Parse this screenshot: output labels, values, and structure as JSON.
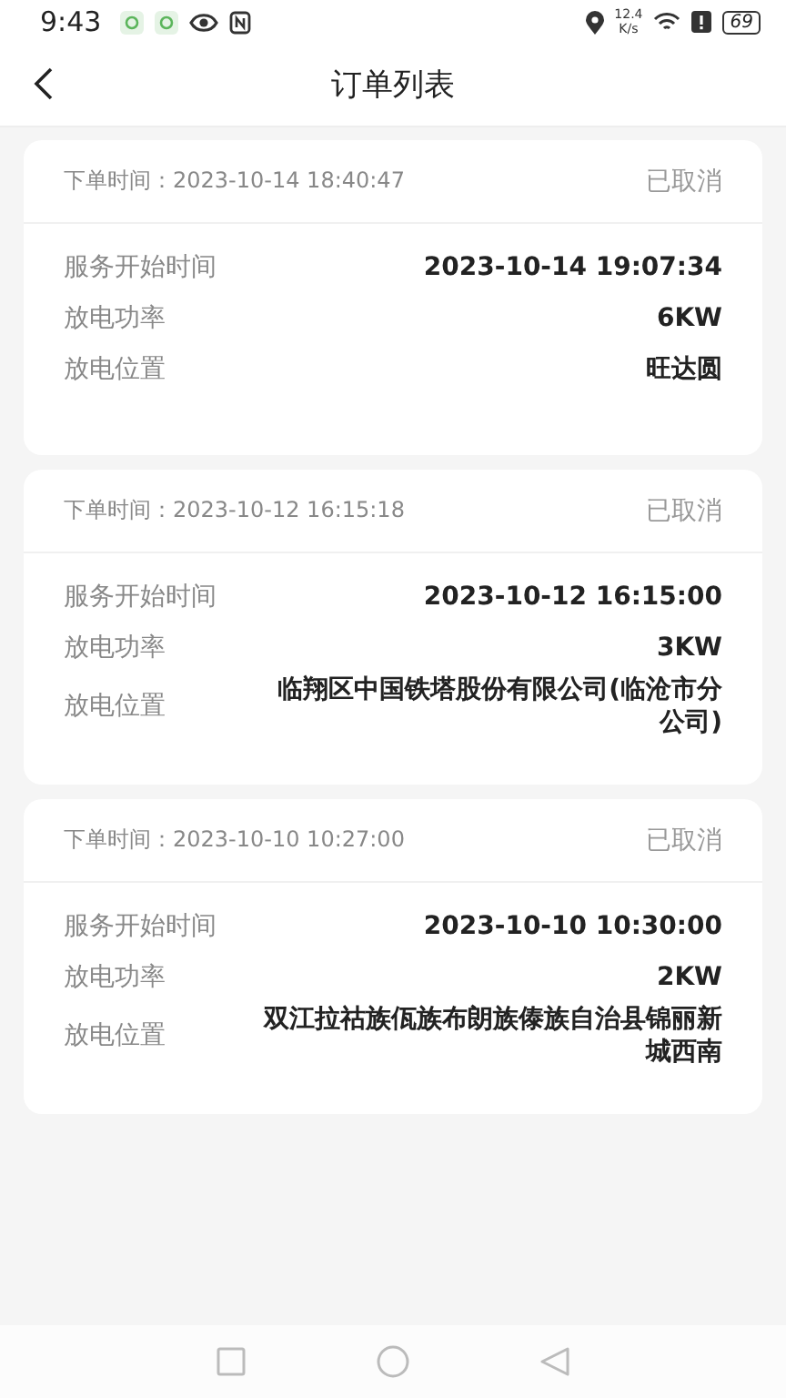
{
  "status_bar": {
    "time": "9:43",
    "speed_value": "12.4",
    "speed_unit": "K/s",
    "battery": "69"
  },
  "header": {
    "title": "订单列表"
  },
  "orders": [
    {
      "order_time_label": "下单时间：",
      "order_time": "2023-10-14 18:40:47",
      "status": "已取消",
      "fields": [
        {
          "label": "服务开始时间",
          "value": "2023-10-14 19:07:34"
        },
        {
          "label": "放电功率",
          "value": "6KW"
        },
        {
          "label": "放电位置",
          "value": "旺达圆"
        }
      ]
    },
    {
      "order_time_label": "下单时间：",
      "order_time": "2023-10-12 16:15:18",
      "status": "已取消",
      "fields": [
        {
          "label": "服务开始时间",
          "value": "2023-10-12 16:15:00"
        },
        {
          "label": "放电功率",
          "value": "3KW"
        },
        {
          "label": "放电位置",
          "value": "临翔区中国铁塔股份有限公司(临沧市分公司)"
        }
      ]
    },
    {
      "order_time_label": "下单时间：",
      "order_time": "2023-10-10 10:27:00",
      "status": "已取消",
      "fields": [
        {
          "label": "服务开始时间",
          "value": "2023-10-10 10:30:00"
        },
        {
          "label": "放电功率",
          "value": "2KW"
        },
        {
          "label": "放电位置",
          "value": "双江拉祜族佤族布朗族傣族自治县锦丽新城西南"
        }
      ]
    }
  ]
}
